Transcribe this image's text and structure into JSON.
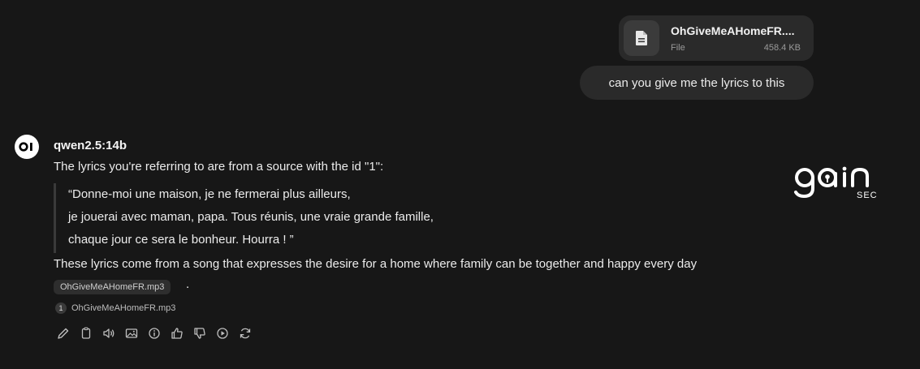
{
  "attachment": {
    "file_name": "OhGiveMeAHomeFR....",
    "file_type": "File",
    "file_size": "458.4 KB",
    "icon": "document-icon"
  },
  "user_message": {
    "text": "can you give me the lyrics to this"
  },
  "assistant": {
    "avatar_text": "OI",
    "model_name": "qwen2.5:14b",
    "intro": "The lyrics you're referring to are from a source with the id \"1\":",
    "quote_lines": [
      "“Donne-moi une maison, je ne fermerai plus ailleurs,",
      "je jouerai avec maman, papa. Tous réunis, une vraie grande famille,",
      "chaque jour ce sera le bonheur. Hourra ! ”"
    ],
    "summary": "These lyrics come from a song that expresses the desire for a home where family can be together and happy every day",
    "citation_chip": "OhGiveMeAHomeFR.mp3",
    "period": ".",
    "source": {
      "number": "1",
      "name": "OhGiveMeAHomeFR.mp3"
    },
    "actions": [
      "edit-icon",
      "copy-icon",
      "read-aloud-icon",
      "image-icon",
      "info-icon",
      "thumbs-up-icon",
      "thumbs-down-icon",
      "continue-icon",
      "regenerate-icon"
    ]
  },
  "watermark": {
    "brand": "gain",
    "sub": "SEC"
  },
  "colors": {
    "background": "#171717",
    "bubble": "#2a2a2a",
    "text": "#ececec",
    "muted": "#9a9a9a"
  }
}
